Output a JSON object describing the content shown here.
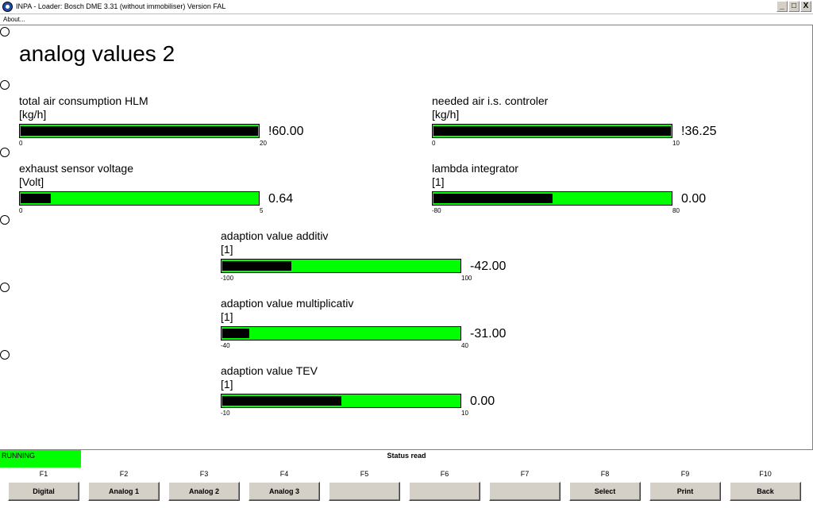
{
  "window": {
    "title": "INPA - Loader:  Bosch DME 3.31 (without immobiliser) Version FAL",
    "minimize": "_",
    "maximize": "□",
    "close": "X"
  },
  "menubar": {
    "about": "About..."
  },
  "page": {
    "title": "analog values 2"
  },
  "gauges": [
    {
      "label": "total air consumption HLM",
      "unit": "[kg/h]",
      "min": "0",
      "max": "20",
      "value": "!60.00",
      "fill": 1.0
    },
    {
      "label": "needed air i.s. controler",
      "unit": "[kg/h]",
      "min": "0",
      "max": "10",
      "value": "!36.25",
      "fill": 1.0
    },
    {
      "label": "exhaust sensor voltage",
      "unit": "[Volt]",
      "min": "0",
      "max": "5",
      "value": "0.64",
      "fill": 0.128
    },
    {
      "label": "lambda integrator",
      "unit": "[1]",
      "min": "-80",
      "max": "80",
      "value": "0.00",
      "fill": 0.5
    },
    {
      "label": "adaption value additiv",
      "unit": "[1]",
      "min": "-100",
      "max": "100",
      "value": "-42.00",
      "fill": 0.29
    },
    {
      "label": "adaption value multiplicativ",
      "unit": "[1]",
      "min": "-40",
      "max": "40",
      "value": "-31.00",
      "fill": 0.1125
    },
    {
      "label": "adaption value TEV",
      "unit": "[1]",
      "min": "-10",
      "max": "10",
      "value": "0.00",
      "fill": 0.5
    }
  ],
  "status": {
    "running": "RUNNING",
    "text": "Status read"
  },
  "fkeys": [
    {
      "key": "F1",
      "label": "Digital"
    },
    {
      "key": "F2",
      "label": "Analog 1"
    },
    {
      "key": "F3",
      "label": "Analog 2"
    },
    {
      "key": "F4",
      "label": "Analog 3"
    },
    {
      "key": "F5",
      "label": ""
    },
    {
      "key": "F6",
      "label": ""
    },
    {
      "key": "F7",
      "label": ""
    },
    {
      "key": "F8",
      "label": "Select"
    },
    {
      "key": "F9",
      "label": "Print"
    },
    {
      "key": "F10",
      "label": "Back"
    }
  ],
  "colors": {
    "bar_green": "#00ff00",
    "bar_fill": "#000000",
    "running_green": "#00ff00"
  }
}
